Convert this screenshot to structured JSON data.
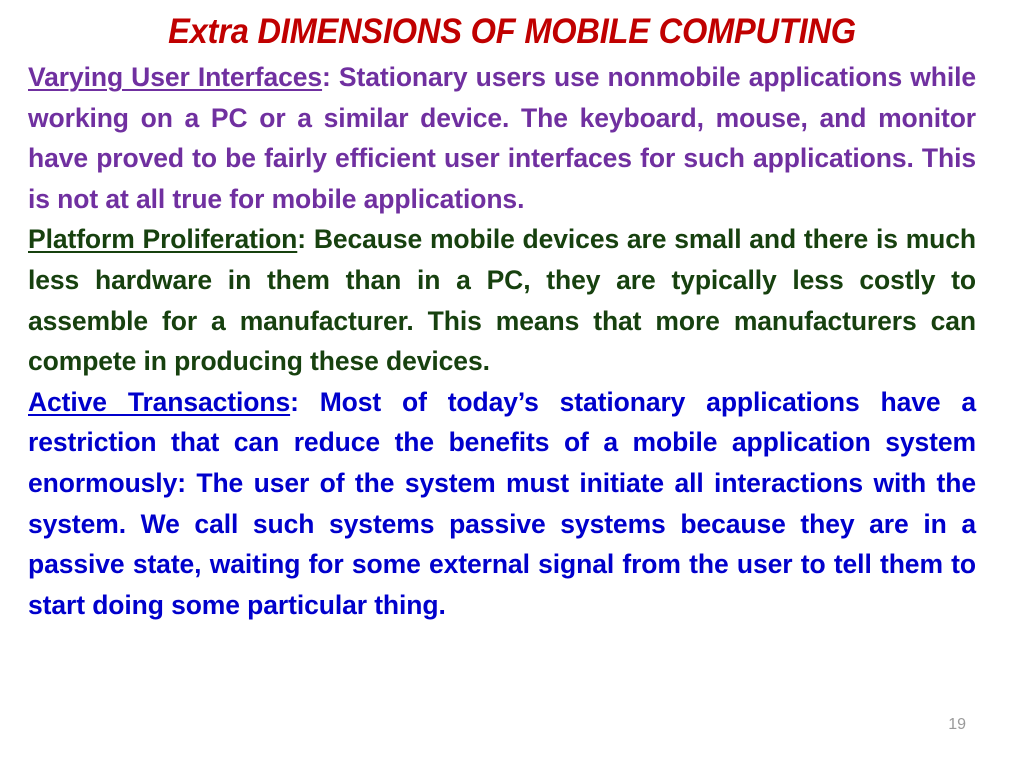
{
  "slide": {
    "background_color": "#FFFFFF",
    "title": "Extra DIMENSIONS OF MOBILE COMPUTING",
    "title_color": "#C00000",
    "page_number": "19",
    "page_number_color": "#9A9A9A"
  },
  "paragraphs": [
    {
      "id": "varying-user-interfaces",
      "lead": "Varying User Interfaces",
      "separator": ": ",
      "body": "Stationary users use nonmobile applications while working on a PC or a similar device. The keyboard, mouse, and monitor have proved to be fairly efficient user interfaces for such applications. This is not at all true for mobile applications.",
      "color": "#7030A0"
    },
    {
      "id": "platform-proliferation",
      "lead": "Platform Proliferation",
      "separator": ": ",
      "body": "Because mobile devices are small and there is much less hardware in them than in a PC, they are typically less costly to assemble for a manufacturer. This means that more manufacturers can compete in producing these devices.",
      "color": "#17410F"
    },
    {
      "id": "active-transactions",
      "lead": "Active Transactions",
      "separator": ": ",
      "body": "Most of today’s stationary applications have a restriction that can reduce the benefits of a mobile application system enormously: The user of the system must initiate all interactions with the system. We call such systems passive systems because they are in a passive state, waiting for some external signal from the user to tell them to start doing some particular thing.",
      "color": "#0000CC"
    }
  ]
}
